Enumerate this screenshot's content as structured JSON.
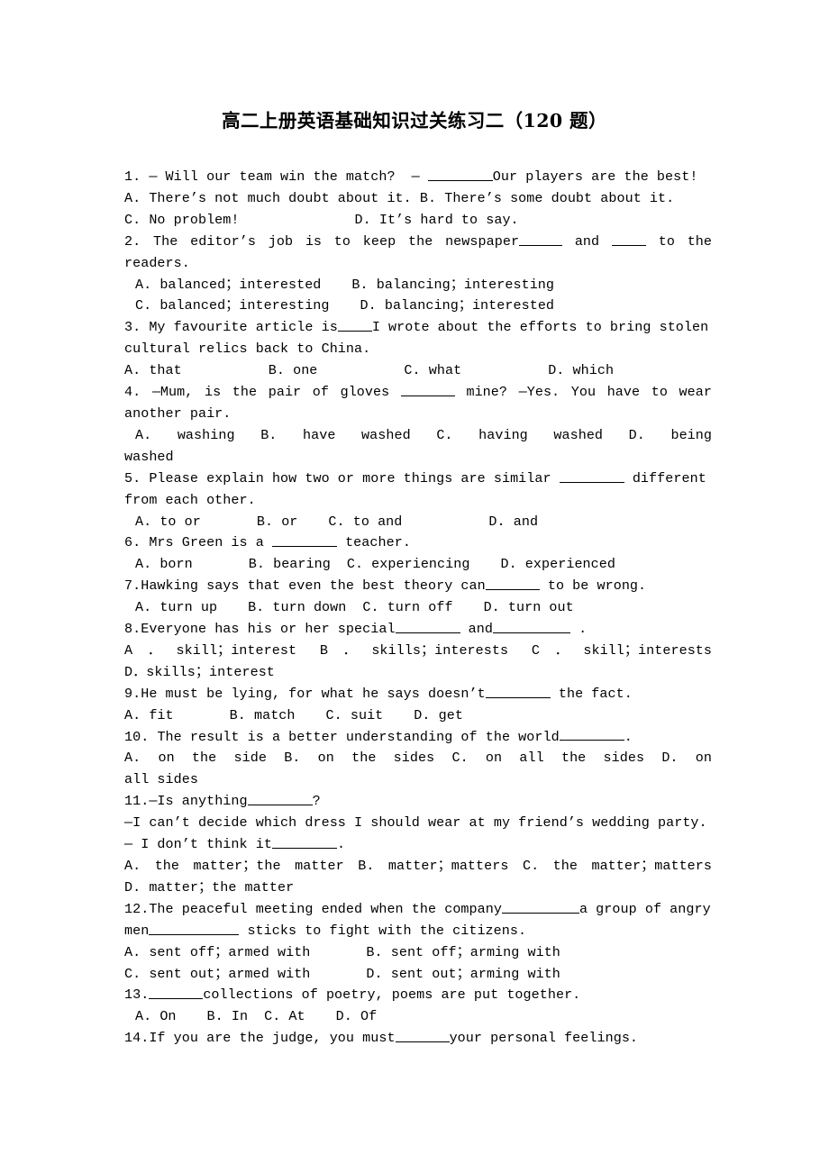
{
  "document": {
    "title": "高二上册英语基础知识过关练习二（120 题）",
    "page_background": "#ffffff",
    "text_color": "#000000"
  },
  "questions": [
    {
      "number": "1.",
      "stem_a": "— Will our team win the match?",
      "stem_b": "—",
      "stem_c": "Our players are the best!",
      "options_line_1_a": "A. There’s not much doubt about it.",
      "options_line_1_b": "B. There’s some doubt about it.",
      "options_line_2_a": "C. No problem!",
      "options_line_2_b": "D. It’s hard to say."
    },
    {
      "number": "2.",
      "stem_a": "The editor’s job is to keep the newspaper",
      "stem_b": "and",
      "stem_c": "to the",
      "stem_d": "readers.",
      "options": [
        "A. balanced；interested",
        "B. balancing；interesting",
        "C. balanced；interesting",
        "D. balancing；interested"
      ]
    },
    {
      "number": "3.",
      "stem_a": "My favourite article is",
      "stem_b": "I wrote about the efforts to bring stolen",
      "stem_c": "cultural relics back to China.",
      "options": [
        "A. that",
        "B. one",
        "C. what",
        "D. which"
      ]
    },
    {
      "number": "4.",
      "stem_a": "—Mum, is the pair of gloves",
      "stem_b": "mine?  —Yes. You have to wear",
      "stem_c": "another pair.",
      "options": [
        "A. washing",
        "B. have washed",
        "C. having washed",
        "D. being"
      ],
      "options_wrap": "washed"
    },
    {
      "number": "5.",
      "stem_a": "Please explain how two or more things are similar",
      "stem_b": "different",
      "stem_c": "from each other.",
      "options": [
        "A. to or",
        "B. or",
        "C. to and",
        "D. and"
      ]
    },
    {
      "number": "6.",
      "stem_a": "Mrs Green is a",
      "stem_b": "teacher.",
      "options": [
        "A. born",
        "B. bearing",
        "C. experiencing",
        "D. experienced"
      ]
    },
    {
      "number": "7.",
      "stem_a": "Hawking says that even the best theory can",
      "stem_b": "to be wrong.",
      "options": [
        "A. turn up",
        "B. turn down",
        "C. turn off",
        "D. turn out"
      ]
    },
    {
      "number": "8.",
      "stem_a": "Everyone has his or her special",
      "stem_b": "and",
      "stem_c": ".",
      "options_line_1": [
        "A．skill；interest",
        "B．skills；interests",
        "C．skill；interests"
      ],
      "options_line_2": "D．skills；interest"
    },
    {
      "number": "9.",
      "stem_a": "He must be lying, for what he says doesn’t",
      "stem_b": "the fact.",
      "options": [
        "A. fit",
        "B. match",
        "C. suit",
        "D. get"
      ]
    },
    {
      "number": "10.",
      "stem_a": "The result is a better understanding of the world",
      "stem_b": ".",
      "options": [
        "A. on the side",
        "B. on the sides",
        "C. on all the sides",
        "D. on"
      ],
      "options_wrap": "all sides"
    },
    {
      "number": "11.",
      "stem_a": "—Is anything",
      "stem_b": "?",
      "stem_c": "—I can’t decide which dress I should wear at my friend’s wedding party.",
      "stem_d": "— I don’t think it",
      "stem_e": ".",
      "options_line_1": [
        "A. the matter；the matter",
        "B. matter；matters",
        "C. the matter；matters"
      ],
      "options_line_2": "D. matter；the matter"
    },
    {
      "number": "12.",
      "stem_a": "The peaceful meeting ended when the company",
      "stem_b": "a group of angry",
      "stem_c": "men",
      "stem_d": "sticks to fight with the citizens.",
      "options_line_1_a": "A. sent off；armed with",
      "options_line_1_b": "B. sent off；arming with",
      "options_line_2_a": "C. sent out；armed with",
      "options_line_2_b": "D. sent out；arming with"
    },
    {
      "number": "13.",
      "stem_a": "collections of poetry, poems are put together.",
      "options": [
        "A. On",
        "B. In",
        "C. At",
        "D. Of"
      ]
    },
    {
      "number": "14.",
      "stem_a": "If you are the judge, you must",
      "stem_b": "your personal feelings."
    }
  ]
}
